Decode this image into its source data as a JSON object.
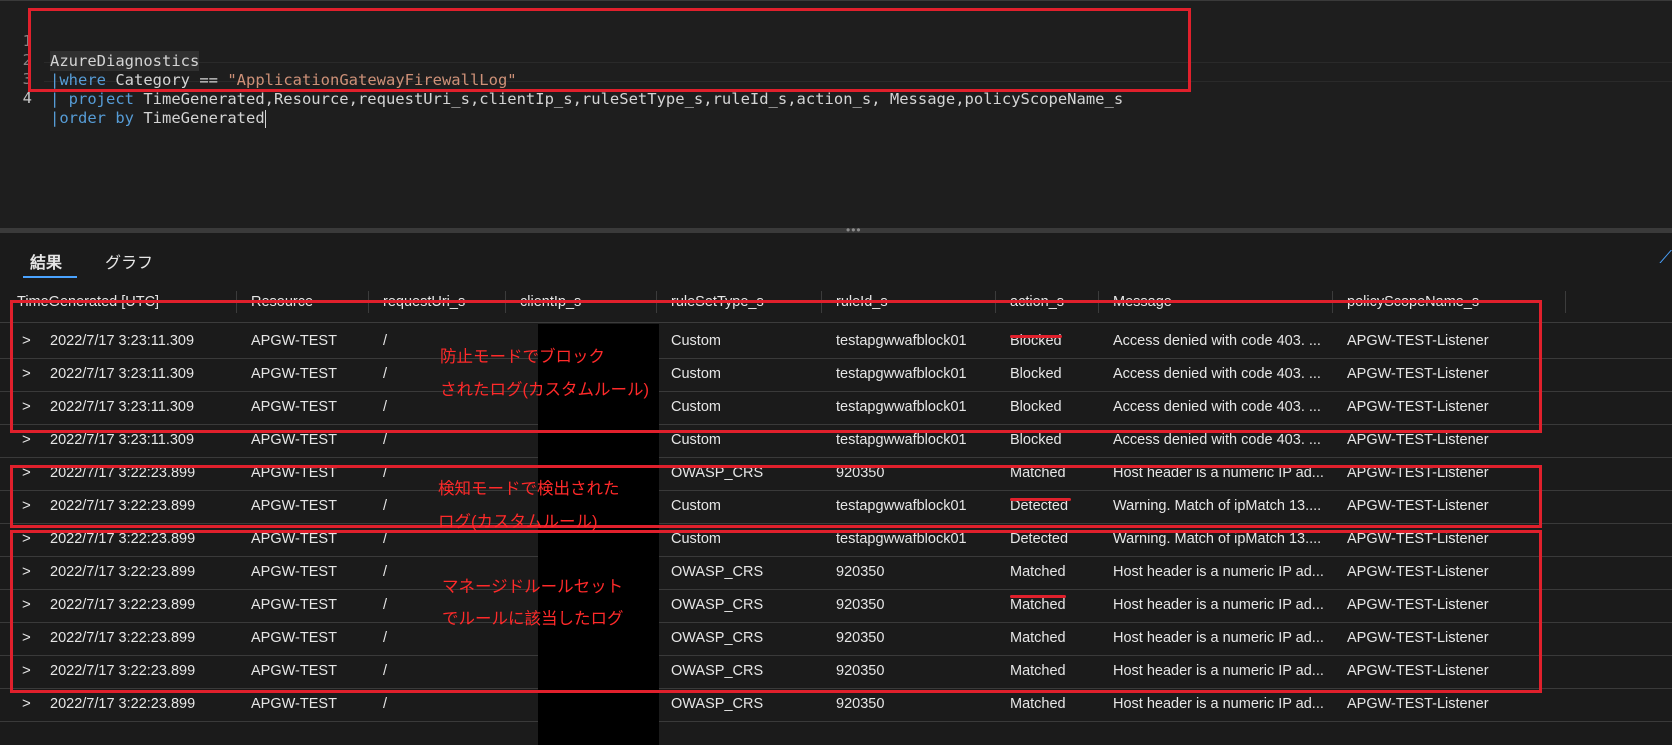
{
  "editor": {
    "lines": [
      {
        "num": "1",
        "text": "AzureDiagnostics"
      },
      {
        "num": "2",
        "pipe": "|",
        "kw": "where",
        "mid": " Category == ",
        "str": "\"ApplicationGatewayFirewallLog\""
      },
      {
        "num": "3",
        "pipe": "| ",
        "kw": "project",
        "rest": " TimeGenerated,Resource,requestUri_s,clientIp_s,ruleSetType_s,ruleId_s,action_s, Message,policyScopeName_s"
      },
      {
        "num": "4",
        "pipe": "|",
        "kw": "order by",
        "rest": " TimeGenerated"
      }
    ]
  },
  "splitter_grip": "•••",
  "tabs": [
    {
      "label": "結果",
      "active": true
    },
    {
      "label": "グラフ",
      "active": false
    }
  ],
  "collapse_icon": "person-icon",
  "table": {
    "columns": [
      "TimeGenerated [UTC]",
      "Resource",
      "requestUri_s",
      "clientIp_s",
      "ruleSetType_s",
      "ruleId_s",
      "action_s",
      "Message",
      "policyScopeName_s"
    ],
    "expander_glyph": ">",
    "rows": [
      [
        "2022/7/17 3:23:11.309",
        "APGW-TEST",
        "/",
        "",
        "Custom",
        "testapgwwafblock01",
        "Blocked",
        "Access denied with code 403. ...",
        "APGW-TEST-Listener"
      ],
      [
        "2022/7/17 3:23:11.309",
        "APGW-TEST",
        "/",
        "",
        "Custom",
        "testapgwwafblock01",
        "Blocked",
        "Access denied with code 403. ...",
        "APGW-TEST-Listener"
      ],
      [
        "2022/7/17 3:23:11.309",
        "APGW-TEST",
        "/",
        "",
        "Custom",
        "testapgwwafblock01",
        "Blocked",
        "Access denied with code 403. ...",
        "APGW-TEST-Listener"
      ],
      [
        "2022/7/17 3:23:11.309",
        "APGW-TEST",
        "/",
        "",
        "Custom",
        "testapgwwafblock01",
        "Blocked",
        "Access denied with code 403. ...",
        "APGW-TEST-Listener"
      ],
      [
        "2022/7/17 3:22:23.899",
        "APGW-TEST",
        "/",
        "",
        "OWASP_CRS",
        "920350",
        "Matched",
        "Host header is a numeric IP ad...",
        "APGW-TEST-Listener"
      ],
      [
        "2022/7/17 3:22:23.899",
        "APGW-TEST",
        "/",
        "",
        "Custom",
        "testapgwwafblock01",
        "Detected",
        "Warning. Match of ipMatch 13....",
        "APGW-TEST-Listener"
      ],
      [
        "2022/7/17 3:22:23.899",
        "APGW-TEST",
        "/",
        "",
        "Custom",
        "testapgwwafblock01",
        "Detected",
        "Warning. Match of ipMatch 13....",
        "APGW-TEST-Listener"
      ],
      [
        "2022/7/17 3:22:23.899",
        "APGW-TEST",
        "/",
        "",
        "OWASP_CRS",
        "920350",
        "Matched",
        "Host header is a numeric IP ad...",
        "APGW-TEST-Listener"
      ],
      [
        "2022/7/17 3:22:23.899",
        "APGW-TEST",
        "/",
        "",
        "OWASP_CRS",
        "920350",
        "Matched",
        "Host header is a numeric IP ad...",
        "APGW-TEST-Listener"
      ],
      [
        "2022/7/17 3:22:23.899",
        "APGW-TEST",
        "/",
        "",
        "OWASP_CRS",
        "920350",
        "Matched",
        "Host header is a numeric IP ad...",
        "APGW-TEST-Listener"
      ],
      [
        "2022/7/17 3:22:23.899",
        "APGW-TEST",
        "/",
        "",
        "OWASP_CRS",
        "920350",
        "Matched",
        "Host header is a numeric IP ad...",
        "APGW-TEST-Listener"
      ],
      [
        "2022/7/17 3:22:23.899",
        "APGW-TEST",
        "/",
        "",
        "OWASP_CRS",
        "920350",
        "Matched",
        "Host header is a numeric IP ad...",
        "APGW-TEST-Listener"
      ]
    ]
  },
  "annotations": {
    "blocked_note": [
      "防止モードでブロック",
      "されたログ(カスタムルール)"
    ],
    "detected_note": [
      "検知モードで検出された",
      "ログ(カスタムルール)"
    ],
    "matched_note": [
      "マネージドルールセット",
      "でルールに該当したログ"
    ]
  },
  "colors": {
    "annotation": "#e0202c",
    "keyword": "#569cd6",
    "string": "#ce9178",
    "accent": "#4aa3ff"
  }
}
